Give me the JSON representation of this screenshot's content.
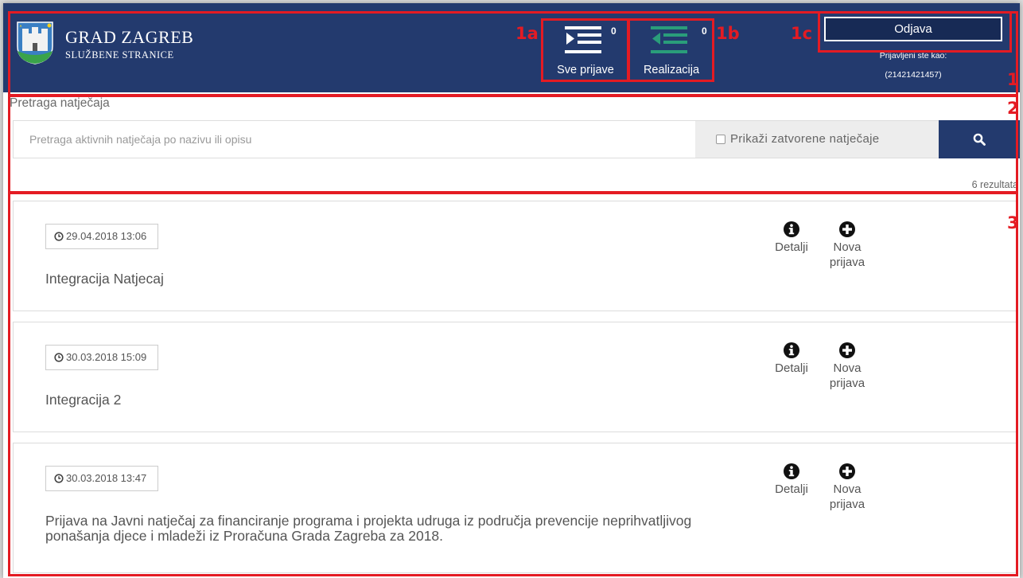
{
  "header": {
    "brand_title": "GRAD ZAGREB",
    "brand_subtitle": "SLUŽBENE STRANICE",
    "nav": [
      {
        "label": "Sve prijave",
        "count": "0",
        "icon": "list-indent-icon"
      },
      {
        "label": "Realizacija",
        "count": "0",
        "icon": "list-outdent-icon"
      }
    ],
    "logout_label": "Odjava",
    "logged_in_label": "Prijavljeni ste kao:",
    "logged_in_user": "(21421421457)"
  },
  "annotations": {
    "n1a": "1a",
    "n1b": "1b",
    "n1c": "1c",
    "n1": "1",
    "n2": "2",
    "n3": "3"
  },
  "search": {
    "title": "Pretraga natječaja",
    "placeholder": "Pretraga aktivnih natječaja po nazivu ili opisu",
    "value": "",
    "closed_label": "Prikaži zatvorene natječaje",
    "closed_checked": false,
    "results": "6 rezultata"
  },
  "cards": [
    {
      "date": "29.04.2018 13:06",
      "title": "Integracija Natjecaj",
      "details": "Detalji",
      "new_line1": "Nova",
      "new_line2": "prijava"
    },
    {
      "date": "30.03.2018 15:09",
      "title": "Integracija 2",
      "details": "Detalji",
      "new_line1": "Nova",
      "new_line2": "prijava"
    },
    {
      "date": "30.03.2018 13:47",
      "title": "Prijava na Javni natječaj za financiranje programa i projekta udruga iz područja prevencije neprihvatljivog ponašanja djece i mladeži iz Proračuna Grada Zagreba za 2018.",
      "details": "Detalji",
      "new_line1": "Nova",
      "new_line2": "prijava"
    }
  ],
  "colors": {
    "header_bg": "#233a6e",
    "annotation": "#e41b23",
    "realizacija_icon": "#2a9d7a"
  }
}
